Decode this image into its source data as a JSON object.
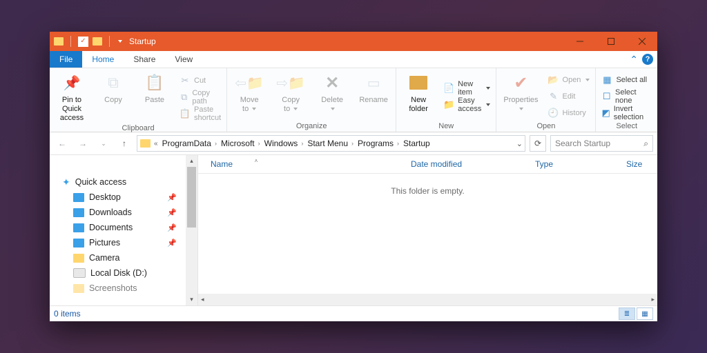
{
  "title": "Startup",
  "tabs": {
    "file": "File",
    "home": "Home",
    "share": "Share",
    "view": "View"
  },
  "ribbon": {
    "clipboard": {
      "pin": "Pin to Quick\naccess",
      "copy": "Copy",
      "paste": "Paste",
      "cut": "Cut",
      "copypath": "Copy path",
      "pasteshort": "Paste shortcut",
      "label": "Clipboard"
    },
    "organize": {
      "move": "Move\nto",
      "copyto": "Copy\nto",
      "delete": "Delete",
      "rename": "Rename",
      "label": "Organize"
    },
    "new": {
      "folder": "New\nfolder",
      "newitem": "New item",
      "easy": "Easy access",
      "label": "New"
    },
    "open": {
      "props": "Properties",
      "open": "Open",
      "edit": "Edit",
      "history": "History",
      "label": "Open"
    },
    "select": {
      "all": "Select all",
      "none": "Select none",
      "invert": "Invert selection",
      "label": "Select"
    }
  },
  "breadcrumb": [
    "ProgramData",
    "Microsoft",
    "Windows",
    "Start Menu",
    "Programs",
    "Startup"
  ],
  "search_placeholder": "Search Startup",
  "sidebar": {
    "quickaccess": "Quick access",
    "items": [
      {
        "label": "Desktop",
        "icon": "blue",
        "pin": true
      },
      {
        "label": "Downloads",
        "icon": "blue",
        "pin": true
      },
      {
        "label": "Documents",
        "icon": "blue",
        "pin": true
      },
      {
        "label": "Pictures",
        "icon": "blue",
        "pin": true
      },
      {
        "label": "Camera",
        "icon": "folder",
        "pin": false
      },
      {
        "label": "Local Disk (D:)",
        "icon": "disk",
        "pin": false
      },
      {
        "label": "Screenshots",
        "icon": "folder",
        "pin": false
      }
    ]
  },
  "columns": {
    "name": "Name",
    "date": "Date modified",
    "type": "Type",
    "size": "Size"
  },
  "empty_msg": "This folder is empty.",
  "status": "0 items"
}
